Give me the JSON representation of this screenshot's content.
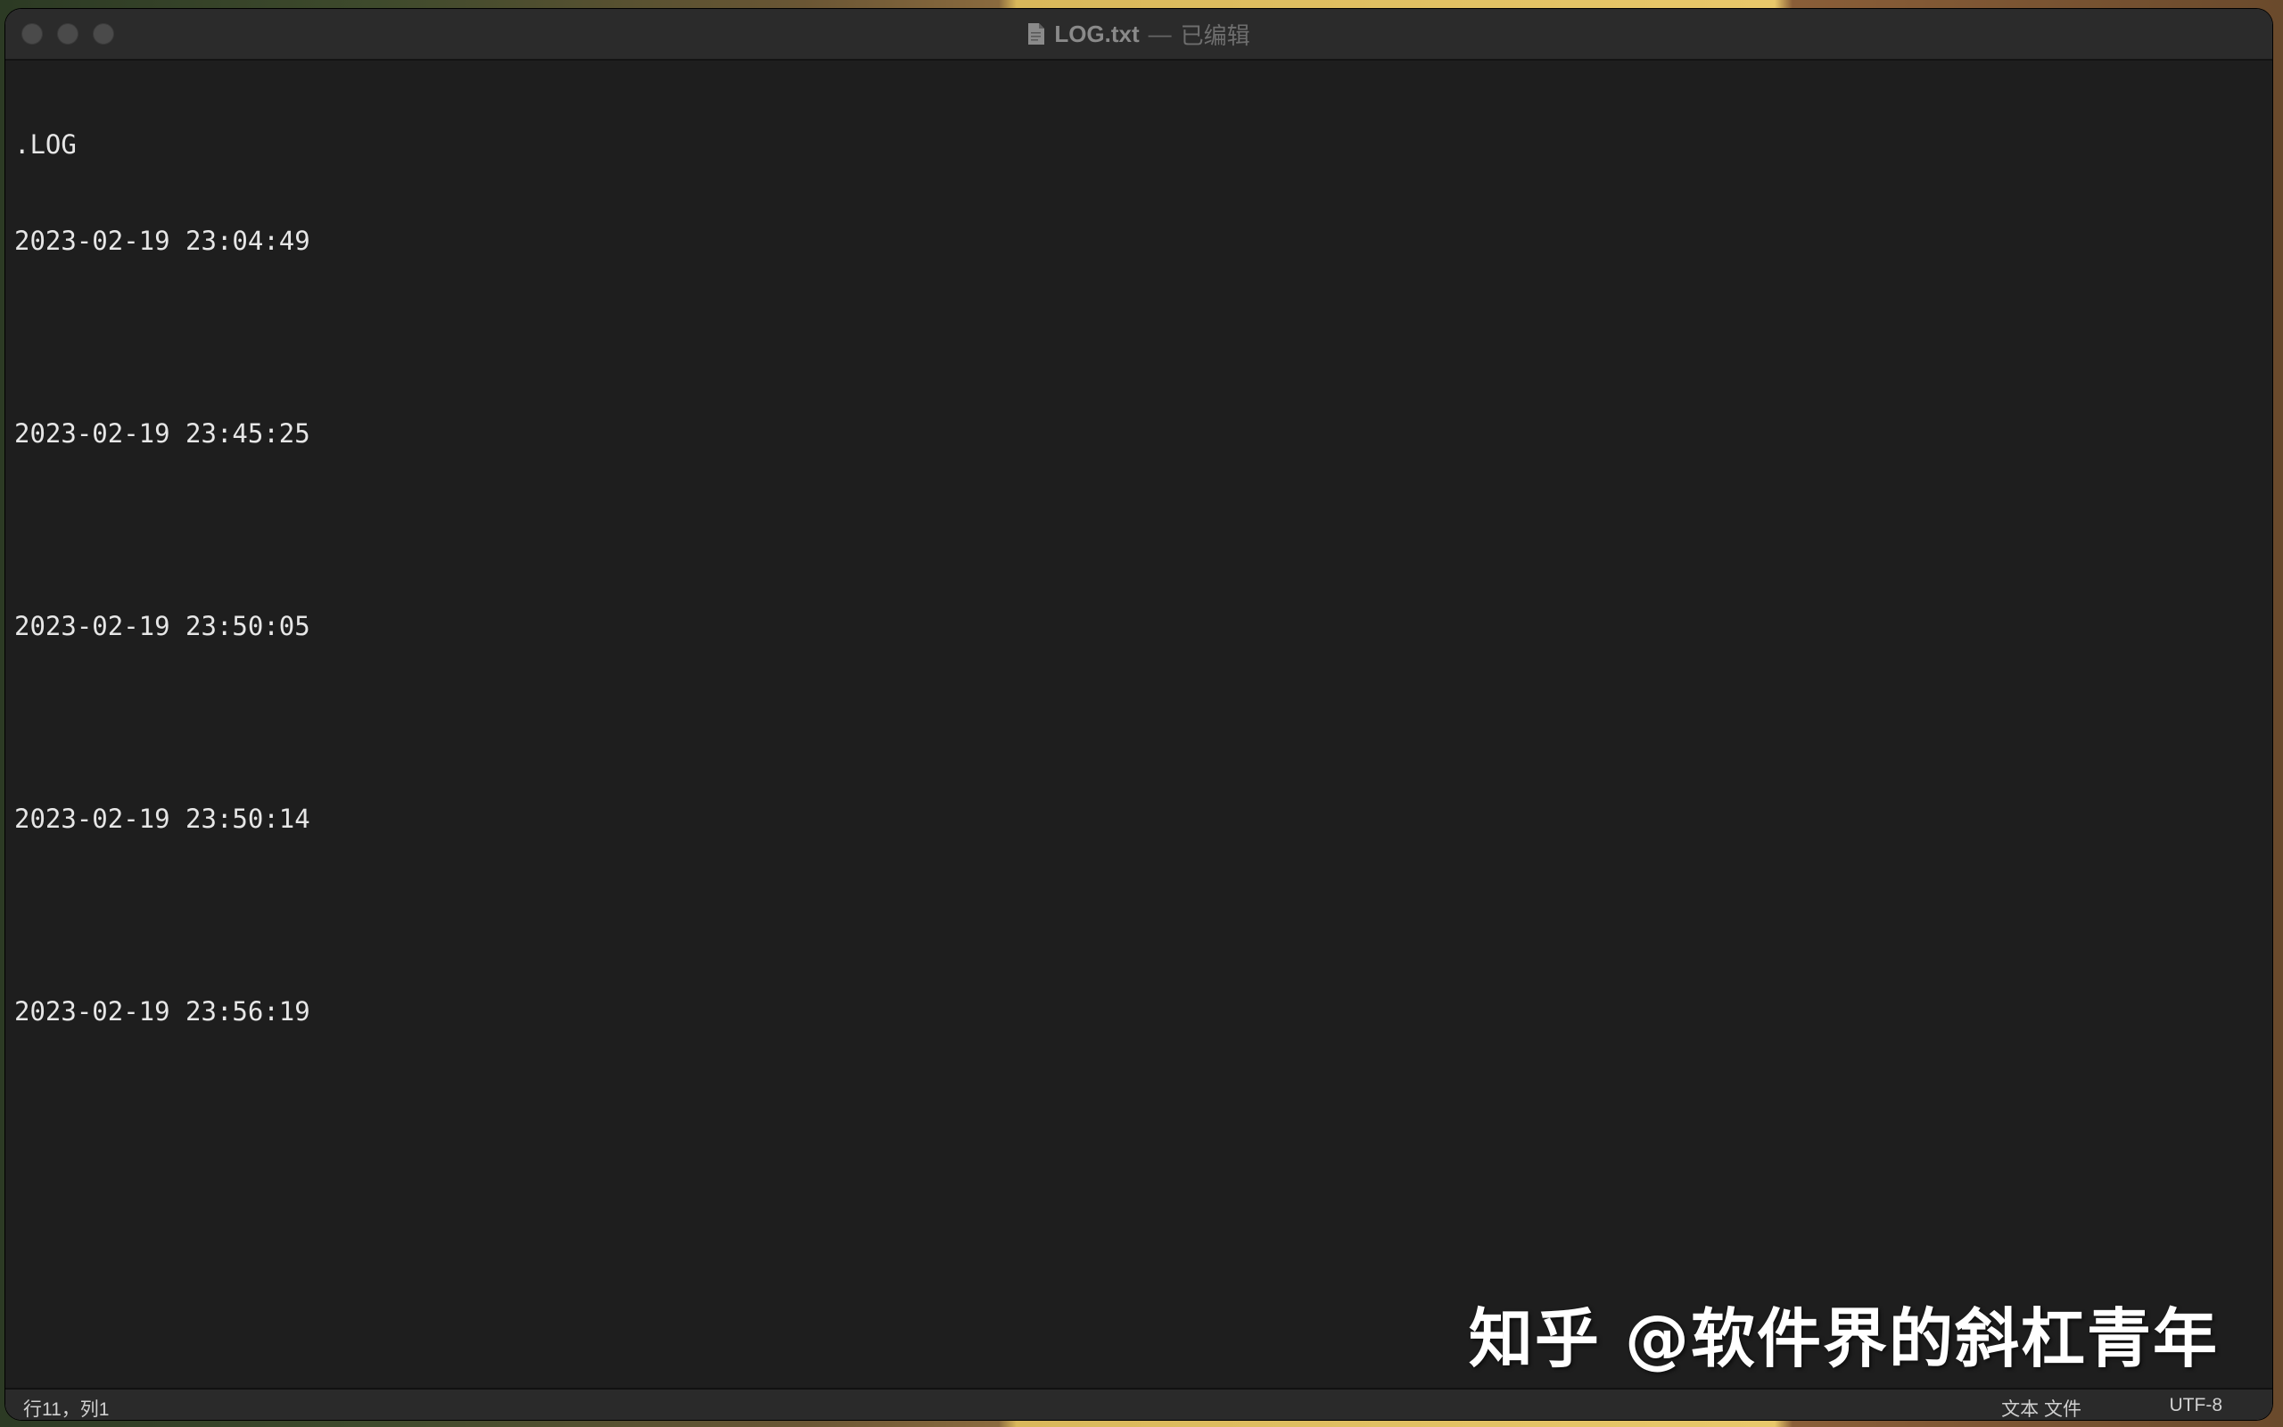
{
  "window": {
    "title": "LOG.txt",
    "separator": "—",
    "status": "已编辑"
  },
  "editor": {
    "lines": [
      ".LOG",
      "2023-02-19 23:04:49",
      "",
      "2023-02-19 23:45:25",
      "",
      "2023-02-19 23:50:05",
      "",
      "2023-02-19 23:50:14",
      "",
      "2023-02-19 23:56:19"
    ]
  },
  "watermark": {
    "text": "知乎 @软件界的斜杠青年"
  },
  "statusbar": {
    "position": "行11，列1",
    "file_type": "文本 文件",
    "encoding": "UTF-8"
  },
  "colors": {
    "editor_bg": "#1e1e1e",
    "text": "#e6e6e6",
    "titlebar_bg": "#2b2b2b"
  },
  "icons": {
    "document": "document-icon"
  }
}
